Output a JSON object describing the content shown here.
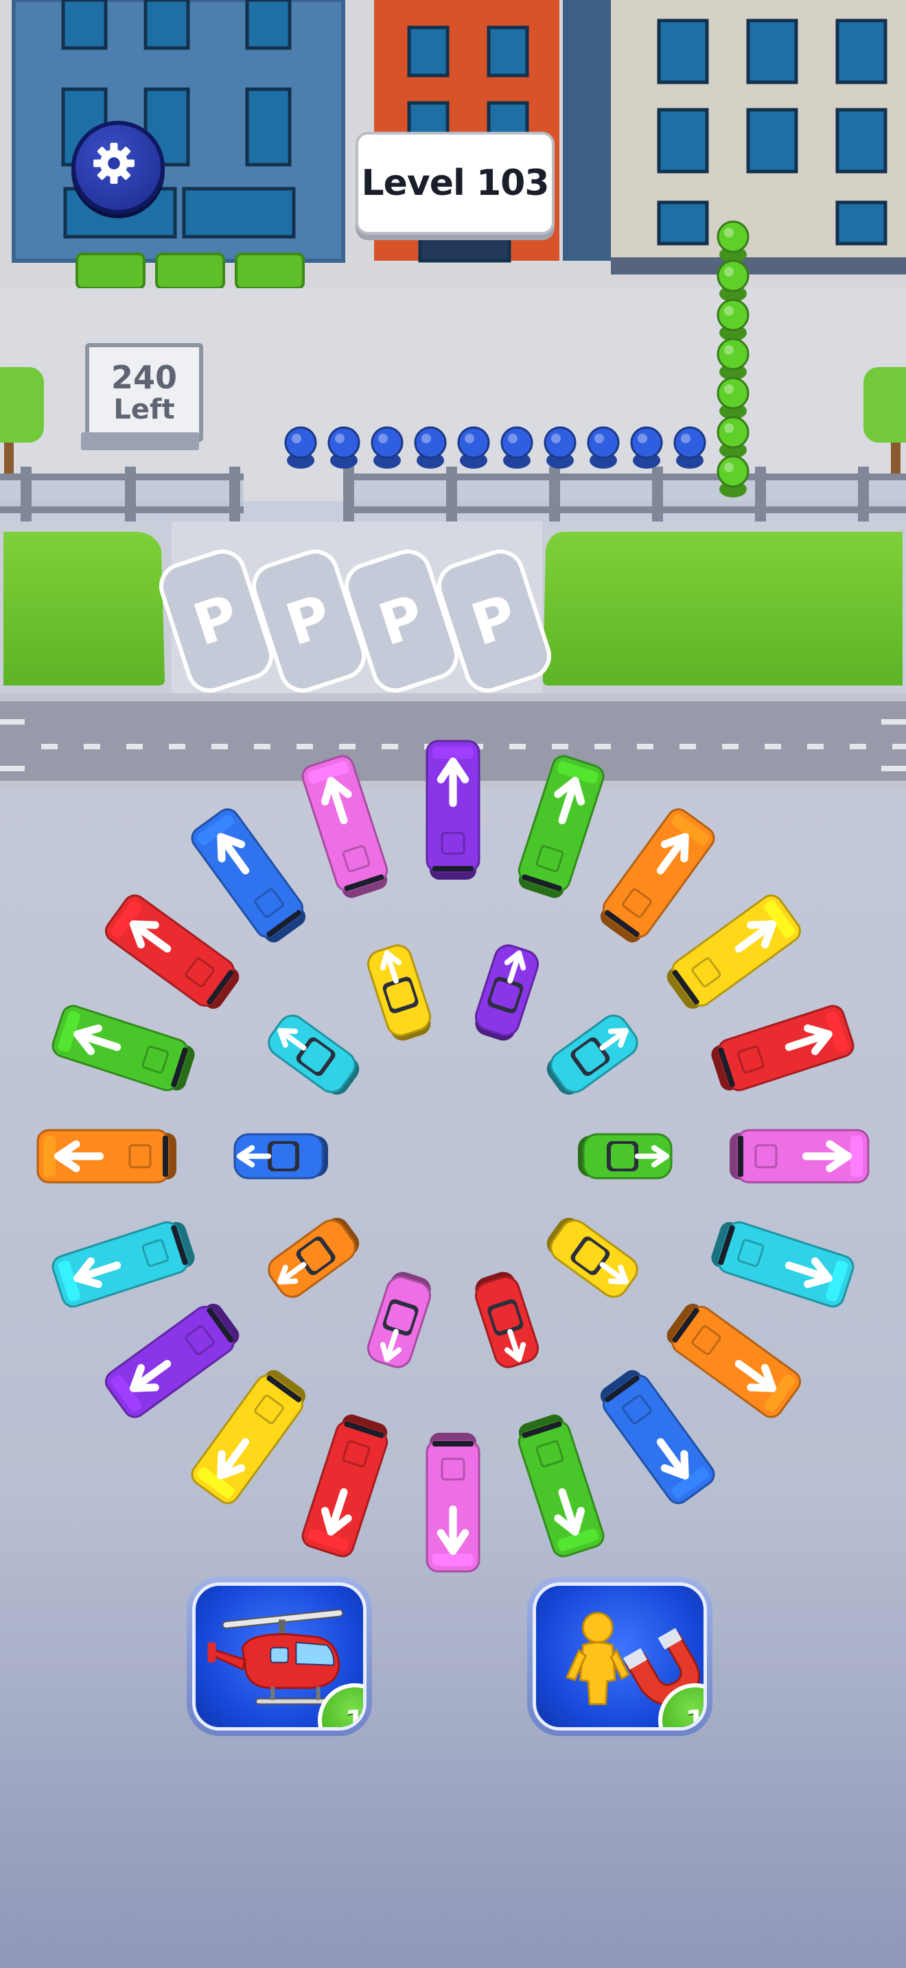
{
  "hud": {
    "settings_icon": "gear-icon",
    "level_label": "Level 103",
    "remaining": {
      "count": "240",
      "label": "Left"
    }
  },
  "parking": {
    "spot_label": "P",
    "spots": 4
  },
  "queue": {
    "blue_people": 10,
    "green_people": 7,
    "colors": {
      "blue": "#2f5fe0",
      "green": "#5fd02a"
    }
  },
  "vehicles": {
    "colors": {
      "red": "#ea2b2f",
      "orange": "#ff8a1c",
      "yellow": "#ffd81a",
      "green": "#49c72a",
      "cyan": "#2fd2e6",
      "blue": "#2f74ee",
      "purple": "#8a36e8",
      "pink": "#ee6ee6"
    },
    "buses": [
      "purple",
      "green",
      "orange",
      "yellow",
      "red",
      "pink",
      "cyan",
      "orange",
      "blue",
      "green",
      "pink",
      "red",
      "yellow",
      "purple",
      "cyan",
      "orange",
      "green",
      "red",
      "blue",
      "pink"
    ],
    "cars": [
      "purple",
      "cyan",
      "green",
      "yellow",
      "red",
      "pink",
      "orange",
      "blue",
      "cyan",
      "yellow"
    ]
  },
  "boosters": {
    "helicopter": {
      "icon": "helicopter-icon",
      "count": "1"
    },
    "magnet": {
      "icon": "magnet-icon",
      "count": "1"
    }
  }
}
